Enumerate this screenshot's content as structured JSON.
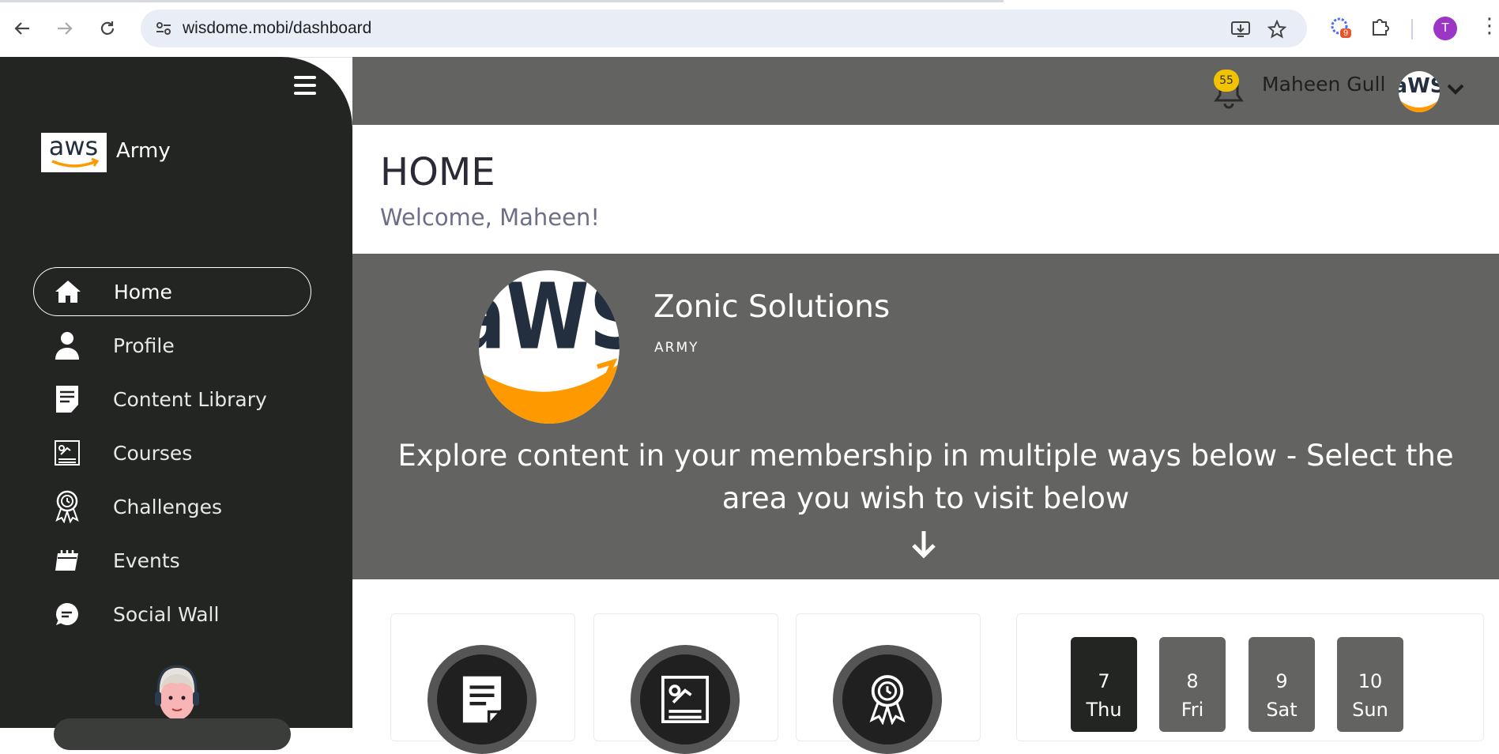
{
  "browser": {
    "url": "wisdome.mobi/dashboard",
    "extension_badge": "9",
    "profile_initial": "T"
  },
  "sidebar": {
    "brand_logo_text": "aws",
    "brand_name": "Army",
    "items": [
      {
        "label": "Home",
        "icon": "home-icon",
        "active": true
      },
      {
        "label": "Profile",
        "icon": "user-icon",
        "active": false
      },
      {
        "label": "Content Library",
        "icon": "document-icon",
        "active": false
      },
      {
        "label": "Courses",
        "icon": "course-board-icon",
        "active": false
      },
      {
        "label": "Challenges",
        "icon": "award-ribbon-icon",
        "active": false
      },
      {
        "label": "Events",
        "icon": "calendar-icon",
        "active": false
      },
      {
        "label": "Social Wall",
        "icon": "chat-bubble-icon",
        "active": false
      }
    ]
  },
  "topbar": {
    "notification_count": "55",
    "user_name": "Maheen Gull"
  },
  "header": {
    "title": "HOME",
    "welcome": "Welcome, Maheen!"
  },
  "hero": {
    "org_name": "Zonic Solutions",
    "org_subtitle": "ARMY",
    "explore_text": "Explore content in your membership in multiple ways below - Select the area you wish to visit below"
  },
  "cards": [
    {
      "icon": "document-icon"
    },
    {
      "icon": "course-board-icon"
    },
    {
      "icon": "award-ribbon-icon"
    }
  ],
  "calendar": {
    "days": [
      {
        "num": "7",
        "name": "Thu",
        "selected": true
      },
      {
        "num": "8",
        "name": "Fri",
        "selected": false
      },
      {
        "num": "9",
        "name": "Sat",
        "selected": false
      },
      {
        "num": "10",
        "name": "Sun",
        "selected": false
      }
    ]
  },
  "colors": {
    "sidebar_bg": "#232523",
    "topbar_bg": "#636462",
    "badge": "#f2c200",
    "aws_orange": "#ff9900",
    "aws_navy": "#232f3e"
  }
}
